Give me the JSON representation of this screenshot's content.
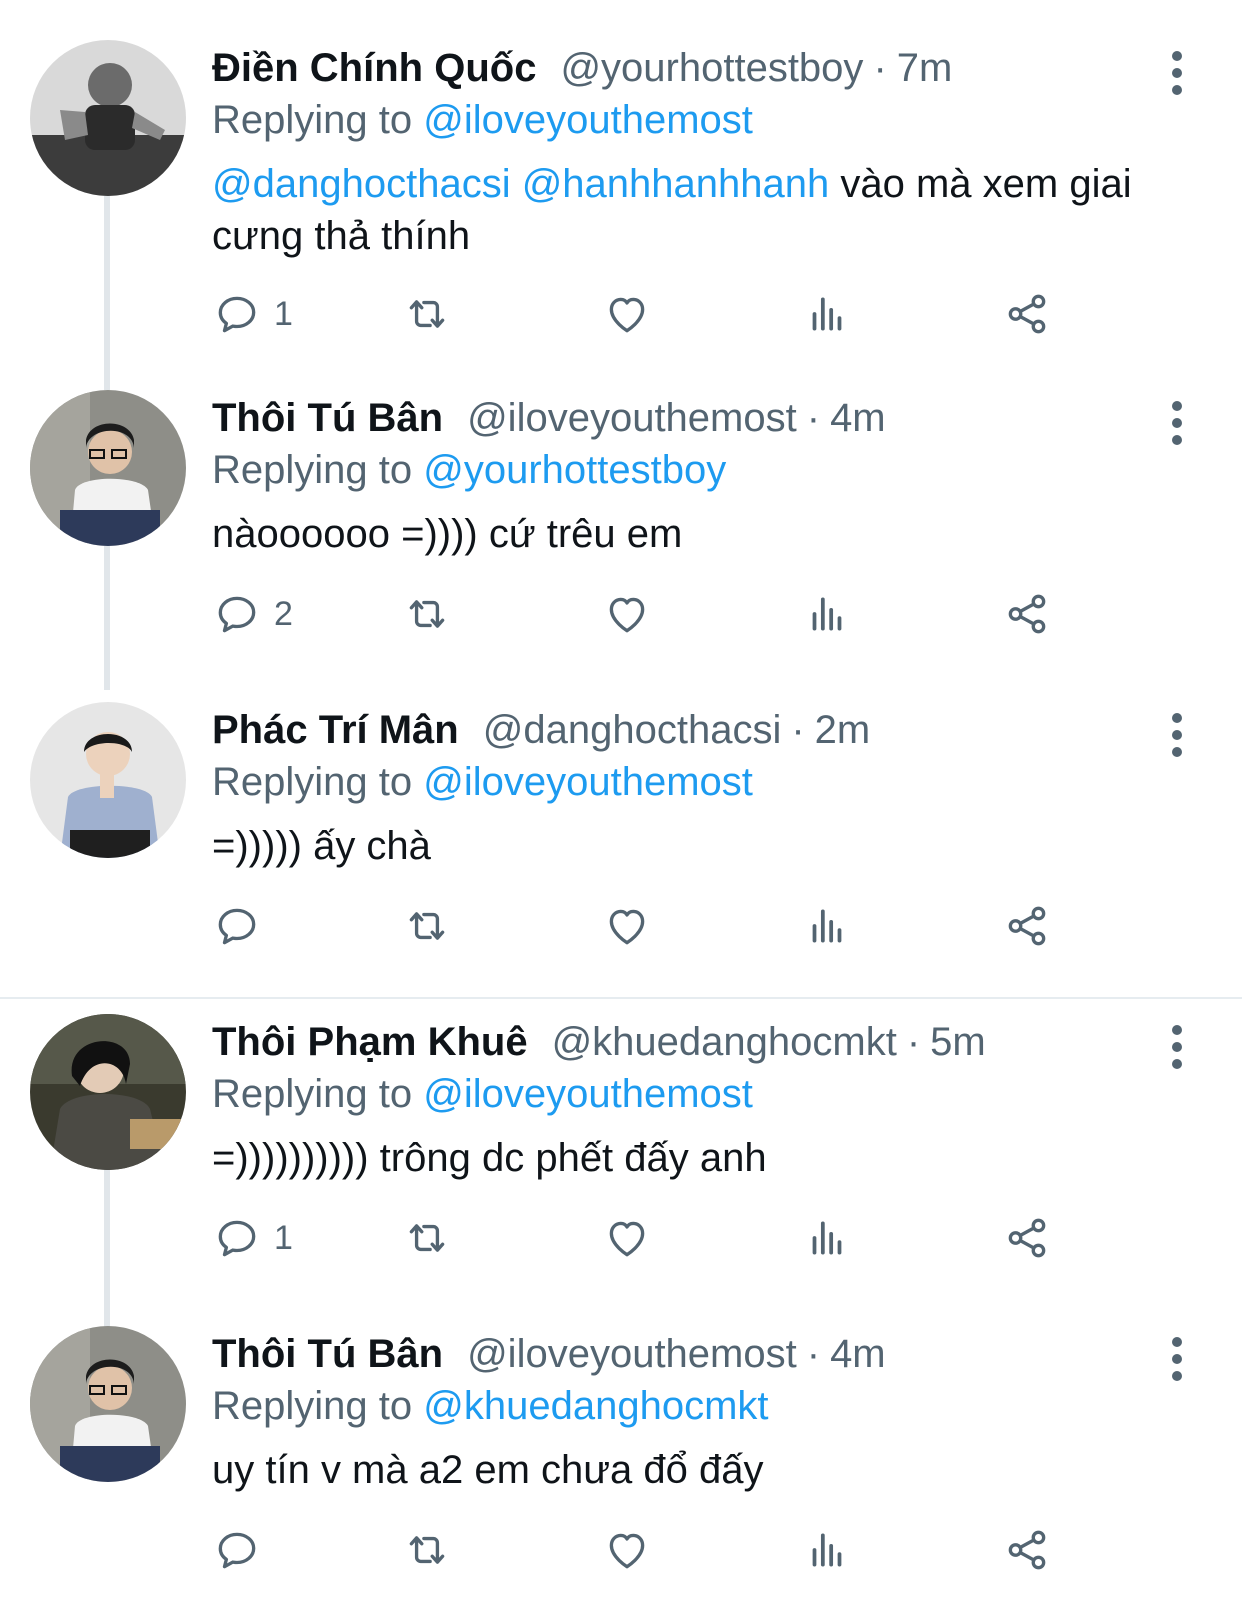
{
  "tweets": [
    {
      "name": "Điền Chính Quốc",
      "handle": "@yourhottestboy",
      "sep": "·",
      "time": "7m",
      "replying_label": "Replying to",
      "replying_to": "@iloveyouthemost",
      "content_mentions": "@danghocthacsi @hanhhanhhanh",
      "content_text": " vào mà xem giai cưng thả thính",
      "reply_count": "1",
      "avatar_icon": "avatar-photo"
    },
    {
      "name": "Thôi Tú Bân",
      "handle": "@iloveyouthemost",
      "sep": "·",
      "time": "4m",
      "replying_label": "Replying to",
      "replying_to": "@yourhottestboy",
      "content_mentions": "",
      "content_text": "nàoooooo =)))) cứ trêu em",
      "reply_count": "2",
      "avatar_icon": "avatar-photo"
    },
    {
      "name": "Phác Trí Mân",
      "handle": "@danghocthacsi",
      "sep": "·",
      "time": "2m",
      "replying_label": "Replying to",
      "replying_to": "@iloveyouthemost",
      "content_mentions": "",
      "content_text": "=))))) ấy chà",
      "reply_count": "",
      "avatar_icon": "avatar-photo"
    },
    {
      "name": "Thôi Phạm Khuê",
      "handle": "@khuedanghocmkt",
      "sep": "·",
      "time": "5m",
      "replying_label": "Replying to",
      "replying_to": "@iloveyouthemost",
      "content_mentions": "",
      "content_text": "=)))))))))) trông dc phết đấy anh",
      "reply_count": "1",
      "avatar_icon": "avatar-photo"
    },
    {
      "name": "Thôi Tú Bân",
      "handle": "@iloveyouthemost",
      "sep": "·",
      "time": "4m",
      "replying_label": "Replying to",
      "replying_to": "@khuedanghocmkt",
      "content_mentions": "",
      "content_text": "uy tín v mà a2 em chưa đổ đấy",
      "reply_count": "",
      "avatar_icon": "avatar-photo"
    }
  ],
  "icons": {
    "reply": "reply-icon",
    "retweet": "retweet-icon",
    "like": "heart-icon",
    "views": "views-icon",
    "share": "share-icon",
    "more": "more-options-icon"
  },
  "colors": {
    "mention": "#1d9bf0",
    "secondary": "#536471",
    "text": "#0f1419",
    "thread_line": "#e1e6ea"
  }
}
